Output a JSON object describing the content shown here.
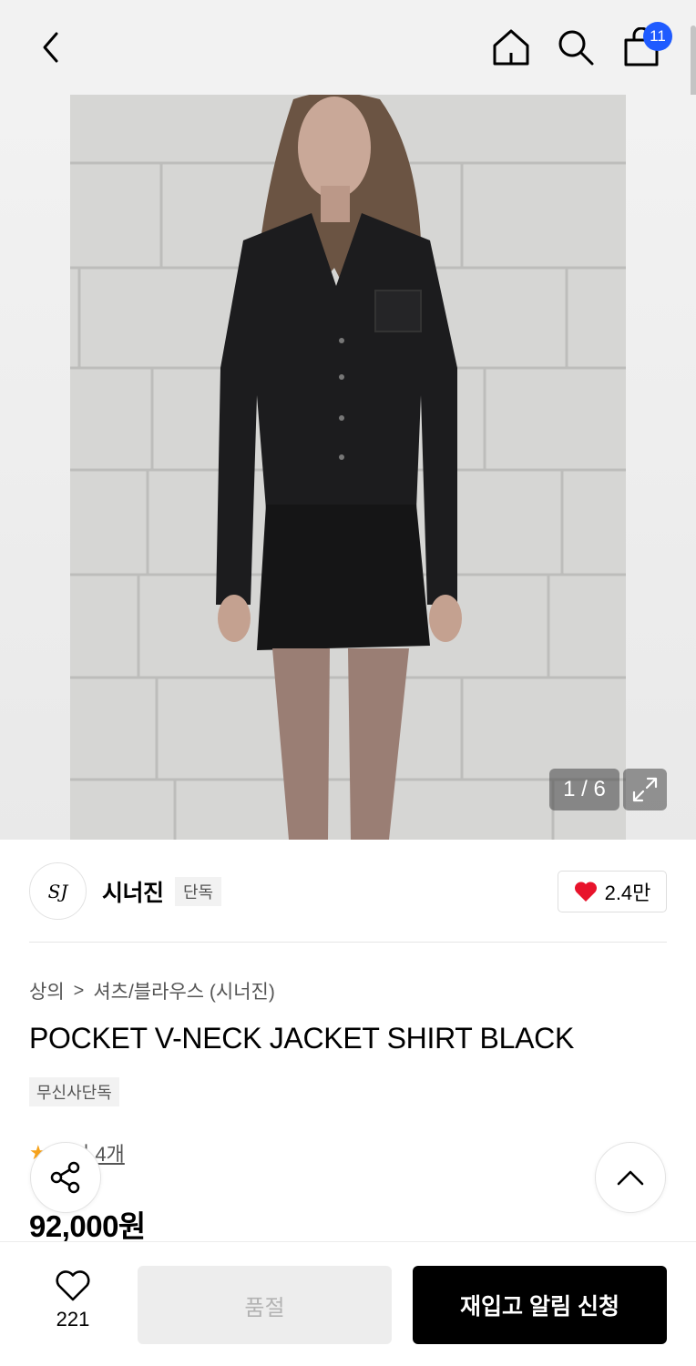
{
  "header": {
    "cart_count": "11",
    "icons": [
      "back-icon",
      "home-icon",
      "search-icon",
      "cart-icon"
    ]
  },
  "gallery": {
    "counter": "1 / 6",
    "expand_icon": "expand-icon"
  },
  "brand": {
    "logo_text": "SJ",
    "name": "시너진",
    "tag": "단독",
    "likes": "2.4만",
    "heart_color": "#e8132b"
  },
  "product": {
    "breadcrumb": [
      "상의",
      "셔츠/블라우스 (시너진)"
    ],
    "breadcrumb_separator": ">",
    "title": "POCKET V-NECK JACKET SHIRT BLACK",
    "exclusive_tag": "무신사단독",
    "review_link": "후기 4개",
    "price": "92,000원"
  },
  "bottom_bar": {
    "wish_count": "221",
    "soldout_label": "품절",
    "restock_label": "재입고 알림 신청"
  },
  "colors": {
    "accent_badge": "#1f5bff",
    "star": "#f6a21b",
    "primary_button": "#000000"
  }
}
